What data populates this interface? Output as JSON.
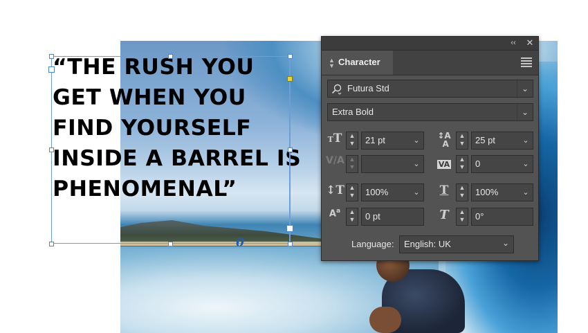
{
  "document": {
    "headline_lines": [
      "“THE RUSH YOU",
      "GET WHEN YOU",
      "FIND YOURSELF",
      "INSIDE A BARREL IS",
      "PHENOMENAL”"
    ],
    "overset_glyph": "0"
  },
  "panel": {
    "title": "Character",
    "collapse_glyph": "‹‹",
    "close_glyph": "✕",
    "font_family": "Futura Std",
    "font_style": "Extra Bold",
    "font_size": "21 pt",
    "leading": "25 pt",
    "kerning": "",
    "tracking": "0",
    "vertical_scale": "100%",
    "horizontal_scale": "100%",
    "baseline_shift": "0 pt",
    "skew": "0°",
    "language_label": "Language:",
    "language": "English: UK"
  },
  "icons": {
    "font_size": "font-size-icon",
    "leading": "leading-icon",
    "kerning": "kerning-icon",
    "tracking": "tracking-icon",
    "vertical_scale": "vertical-scale-icon",
    "horizontal_scale": "horizontal-scale-icon",
    "baseline_shift": "baseline-shift-icon",
    "skew": "skew-icon",
    "search": "search-icon",
    "panel_menu": "hamburger-menu-icon"
  },
  "colors": {
    "panel_bg": "#535353",
    "field_bg": "#454545",
    "frame_accent": "#6d9fd6",
    "handle_yellow": "#e7d534"
  }
}
